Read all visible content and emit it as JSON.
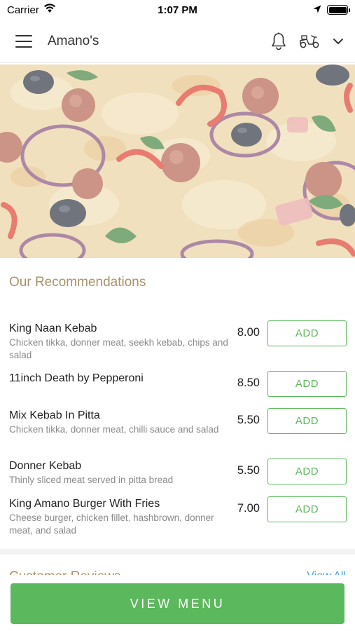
{
  "status_bar": {
    "carrier": "Carrier",
    "time": "1:07 PM",
    "battery_level": 1.0
  },
  "nav": {
    "title": "Amano's",
    "icons": [
      "hamburger-menu-icon",
      "bell-icon",
      "scooter-icon",
      "chevron-down-icon"
    ]
  },
  "hero": {
    "icon": "pizza-photo"
  },
  "recommendations": {
    "title": "Our Recommendations",
    "add_label": "ADD",
    "items": [
      {
        "name": "King Naan Kebab",
        "description": "Chicken tikka, donner meat, seekh kebab, chips and salad",
        "price": "8.00"
      },
      {
        "name": "11inch Death by Pepperoni",
        "description": "",
        "price": "8.50"
      },
      {
        "name": "Mix Kebab In Pitta",
        "description": "Chicken tikka, donner meat, chilli sauce and salad",
        "price": "5.50"
      },
      {
        "name": "Donner Kebab",
        "description": "Thinly sliced meat served in pitta bread",
        "price": "5.50"
      },
      {
        "name": "King Amano Burger With Fries",
        "description": "Cheese burger, chicken fillet, hashbrown, donner meat, and salad",
        "price": "7.00"
      }
    ]
  },
  "reviews": {
    "title": "Customer Reviews",
    "view_all": "View All"
  },
  "footer": {
    "view_menu_label": "VIEW MENU"
  },
  "colors": {
    "accent_green": "#5cb85c",
    "section_title": "#a8936a",
    "link_blue": "#4aa3d8"
  }
}
